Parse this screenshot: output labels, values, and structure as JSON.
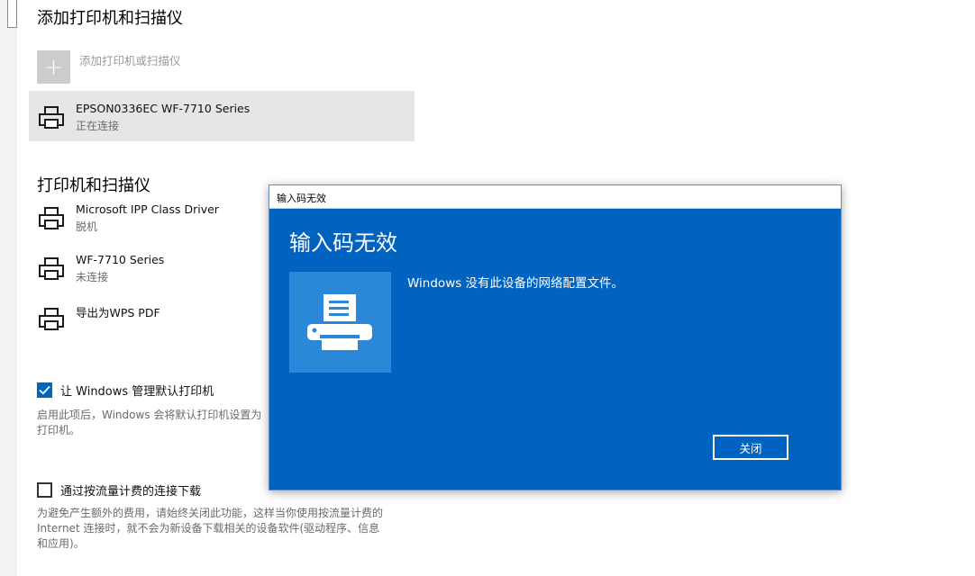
{
  "settings": {
    "add_section": {
      "title": "添加打印机和扫描仪",
      "add_button_label": "添加打印机或扫描仪",
      "pending_device": {
        "name": "EPSON0336EC WF-7710 Series",
        "status": "正在连接"
      }
    },
    "printers_section": {
      "title": "打印机和扫描仪",
      "items": [
        {
          "name": "Microsoft IPP Class Driver",
          "status": "脱机"
        },
        {
          "name": "WF-7710 Series",
          "status": "未连接"
        },
        {
          "name": "导出为WPS PDF",
          "status": ""
        }
      ]
    },
    "manage_default": {
      "label": "让 Windows 管理默认打印机",
      "checked": true,
      "description_line1": "启用此项后，Windows 会将默认打印机设置为",
      "description_line2": "打印机。"
    },
    "metered_download": {
      "label": "通过按流量计费的连接下载",
      "checked": false,
      "description_line1": "为避免产生额外的费用，请始终关闭此功能，这样当你使用按流量计费的",
      "description_line2": "Internet 连接时，就不会为新设备下载相关的设备软件(驱动程序、信息",
      "description_line3": "和应用)。"
    }
  },
  "dialog": {
    "window_title": "输入码无效",
    "heading": "输入码无效",
    "message": "Windows 没有此设备的网络配置文件。",
    "close_label": "关闭",
    "icon": "printer-icon"
  },
  "colors": {
    "dialog_bg": "#0063c0",
    "dialog_tile": "#2b88d8",
    "checkbox_accent": "#0067c0",
    "selected_row": "#e6e6e6"
  }
}
